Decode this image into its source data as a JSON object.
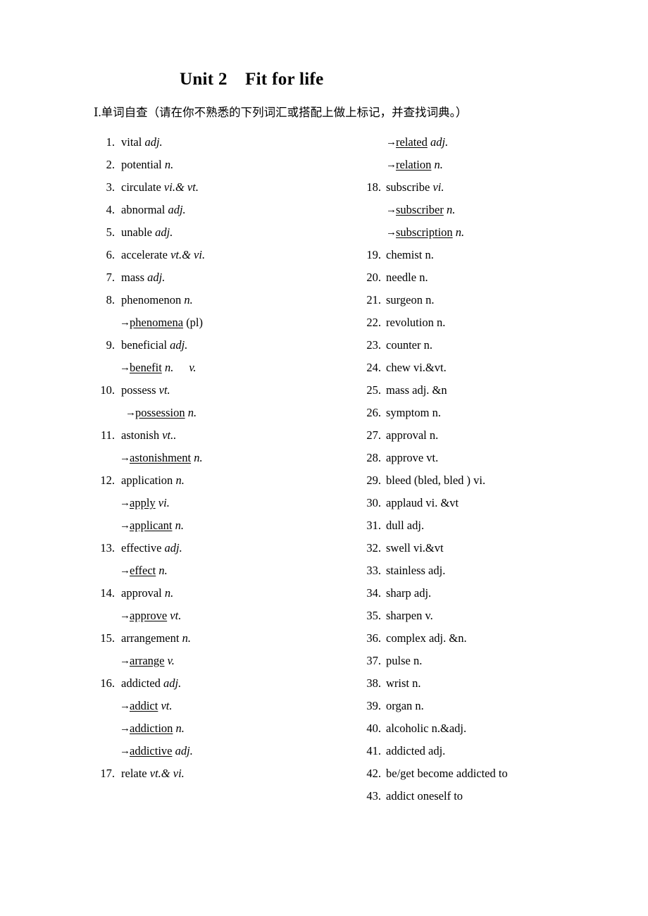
{
  "document": {
    "title": "Unit 2　Fit for life",
    "section_heading": "Ⅰ.单词自查（请在你不熟悉的下列词汇或搭配上做上标记，并查找词典。）",
    "arrow_glyph": "→"
  },
  "left_column": [
    {
      "num": "1.",
      "word": "vital",
      "pos": "adj.",
      "italic": true
    },
    {
      "num": "2.",
      "word": "potential",
      "pos": "n.",
      "italic": true
    },
    {
      "num": "3.",
      "word": "circulate",
      "pos": "vi.& vt.",
      "italic": true
    },
    {
      "num": "4.",
      "word": "abnormal",
      "pos": "adj.",
      "italic": true
    },
    {
      "num": "5.",
      "word": "unable",
      "pos": "adj.",
      "italic": true
    },
    {
      "num": "6.",
      "word": "accelerate",
      "pos": "vt.& vi.",
      "italic": true
    },
    {
      "num": "7.",
      "word": "mass",
      "pos": "adj.",
      "italic": true
    },
    {
      "num": "8.",
      "word": "phenomenon",
      "pos": "n.",
      "italic": true
    },
    {
      "sub": true,
      "word": "phenomena",
      "pos": "(pl)",
      "italic": false
    },
    {
      "num": "9.",
      "word": "beneficial",
      "pos": "adj.",
      "italic": true
    },
    {
      "sub": true,
      "word": "benefit",
      "pos": "n.",
      "pos2": "v.",
      "italic": true
    },
    {
      "num": "10.",
      "word": "possess",
      "pos": "vt.",
      "italic": true
    },
    {
      "sub": true,
      "word": "possession",
      "pos": "n.",
      "italic": true,
      "indent_more": true
    },
    {
      "num": "11.",
      "word": "astonish",
      "pos": "vt..",
      "italic": true
    },
    {
      "sub": true,
      "word": "astonishment",
      "pos": "n.",
      "italic": true
    },
    {
      "num": "12.",
      "word": "application",
      "pos": "n.",
      "italic": true
    },
    {
      "sub": true,
      "word": "apply",
      "pos": "vi.",
      "italic": true
    },
    {
      "sub": true,
      "word": "applicant",
      "pos": "n.",
      "italic": true
    },
    {
      "num": "13.",
      "word": "effective",
      "pos": "adj.",
      "italic": true
    },
    {
      "sub": true,
      "word": "effect",
      "pos": "n.",
      "italic": true
    },
    {
      "num": "14.",
      "word": "approval",
      "pos": "n.",
      "italic": true
    },
    {
      "sub": true,
      "word": "approve",
      "pos": "vt.",
      "italic": true
    },
    {
      "num": "15.",
      "word": "arrangement",
      "pos": "n.",
      "italic": true
    },
    {
      "sub": true,
      "word": "arrange",
      "pos": "v.",
      "italic": true
    },
    {
      "num": "16.",
      "word": "addicted",
      "pos": "adj.",
      "italic": true
    },
    {
      "sub": true,
      "word": "addict",
      "pos": "vt.",
      "italic": true
    },
    {
      "sub": true,
      "word": "addiction",
      "pos": "n.",
      "italic": true
    },
    {
      "sub": true,
      "word": "addictive",
      "pos": "adj.",
      "italic": true
    },
    {
      "num": "17.",
      "word": "relate",
      "pos": "vt.& vi.",
      "italic": true
    }
  ],
  "right_column": [
    {
      "sub": true,
      "word": "related",
      "pos": "adj.",
      "italic": true
    },
    {
      "sub": true,
      "word": "relation",
      "pos": "n.",
      "italic": true
    },
    {
      "num": "18.",
      "word": "subscribe",
      "pos": "vi.",
      "italic": true
    },
    {
      "sub": true,
      "word": "subscriber",
      "pos": "n.",
      "italic": true
    },
    {
      "sub": true,
      "word": "subscription",
      "pos": "n.",
      "italic": true
    },
    {
      "num": "19.",
      "word": "chemist",
      "pos": "n.",
      "italic": false
    },
    {
      "num": "20.",
      "word": "needle",
      "pos": "n.",
      "italic": false
    },
    {
      "num": "21.",
      "word": "surgeon",
      "pos": "n.",
      "italic": false
    },
    {
      "num": "22.",
      "word": "revolution",
      "pos": "n.",
      "italic": false
    },
    {
      "num": "23.",
      "word": "counter",
      "pos": "n.",
      "italic": false
    },
    {
      "num": "24.",
      "word": "chew",
      "pos": "vi.&vt.",
      "italic": false
    },
    {
      "num": "25.",
      "word": "mass",
      "pos": "adj. &n",
      "italic": false
    },
    {
      "num": "26.",
      "word": "symptom",
      "pos": "n.",
      "italic": false
    },
    {
      "num": "27.",
      "word": "approval",
      "pos": "n.",
      "italic": false
    },
    {
      "num": "28.",
      "word": "approve",
      "pos": "vt.",
      "italic": false
    },
    {
      "num": "29.",
      "word": "bleed (bled, bled )",
      "pos": "vi.",
      "italic": false
    },
    {
      "num": "30.",
      "word": "applaud",
      "pos": "vi. &vt",
      "italic": false
    },
    {
      "num": "31.",
      "word": "dull",
      "pos": "adj.",
      "italic": false
    },
    {
      "num": "32.",
      "word": "swell",
      "pos": "vi.&vt",
      "italic": false
    },
    {
      "num": "33.",
      "word": "stainless",
      "pos": "adj.",
      "italic": false
    },
    {
      "num": "34.",
      "word": "sharp",
      "pos": "adj.",
      "italic": false
    },
    {
      "num": "35.",
      "word": "sharpen",
      "pos": "v.",
      "italic": false
    },
    {
      "num": "36.",
      "word": "complex",
      "pos": "adj. &n.",
      "italic": false
    },
    {
      "num": "37.",
      "word": "pulse",
      "pos": "n.",
      "italic": false
    },
    {
      "num": "38.",
      "word": "wrist",
      "pos": "n.",
      "italic": false
    },
    {
      "num": "39.",
      "word": "organ",
      "pos": "n.",
      "italic": false
    },
    {
      "num": "40.",
      "word": "alcoholic",
      "pos": "n.&adj.",
      "italic": false
    },
    {
      "num": "41.",
      "word": "addicted",
      "pos": "adj.",
      "italic": false
    },
    {
      "num": "42.",
      "word": "be/get become addicted to",
      "pos": "",
      "italic": false
    },
    {
      "num": "43.",
      "word": "addict oneself to",
      "pos": "",
      "italic": false
    }
  ]
}
